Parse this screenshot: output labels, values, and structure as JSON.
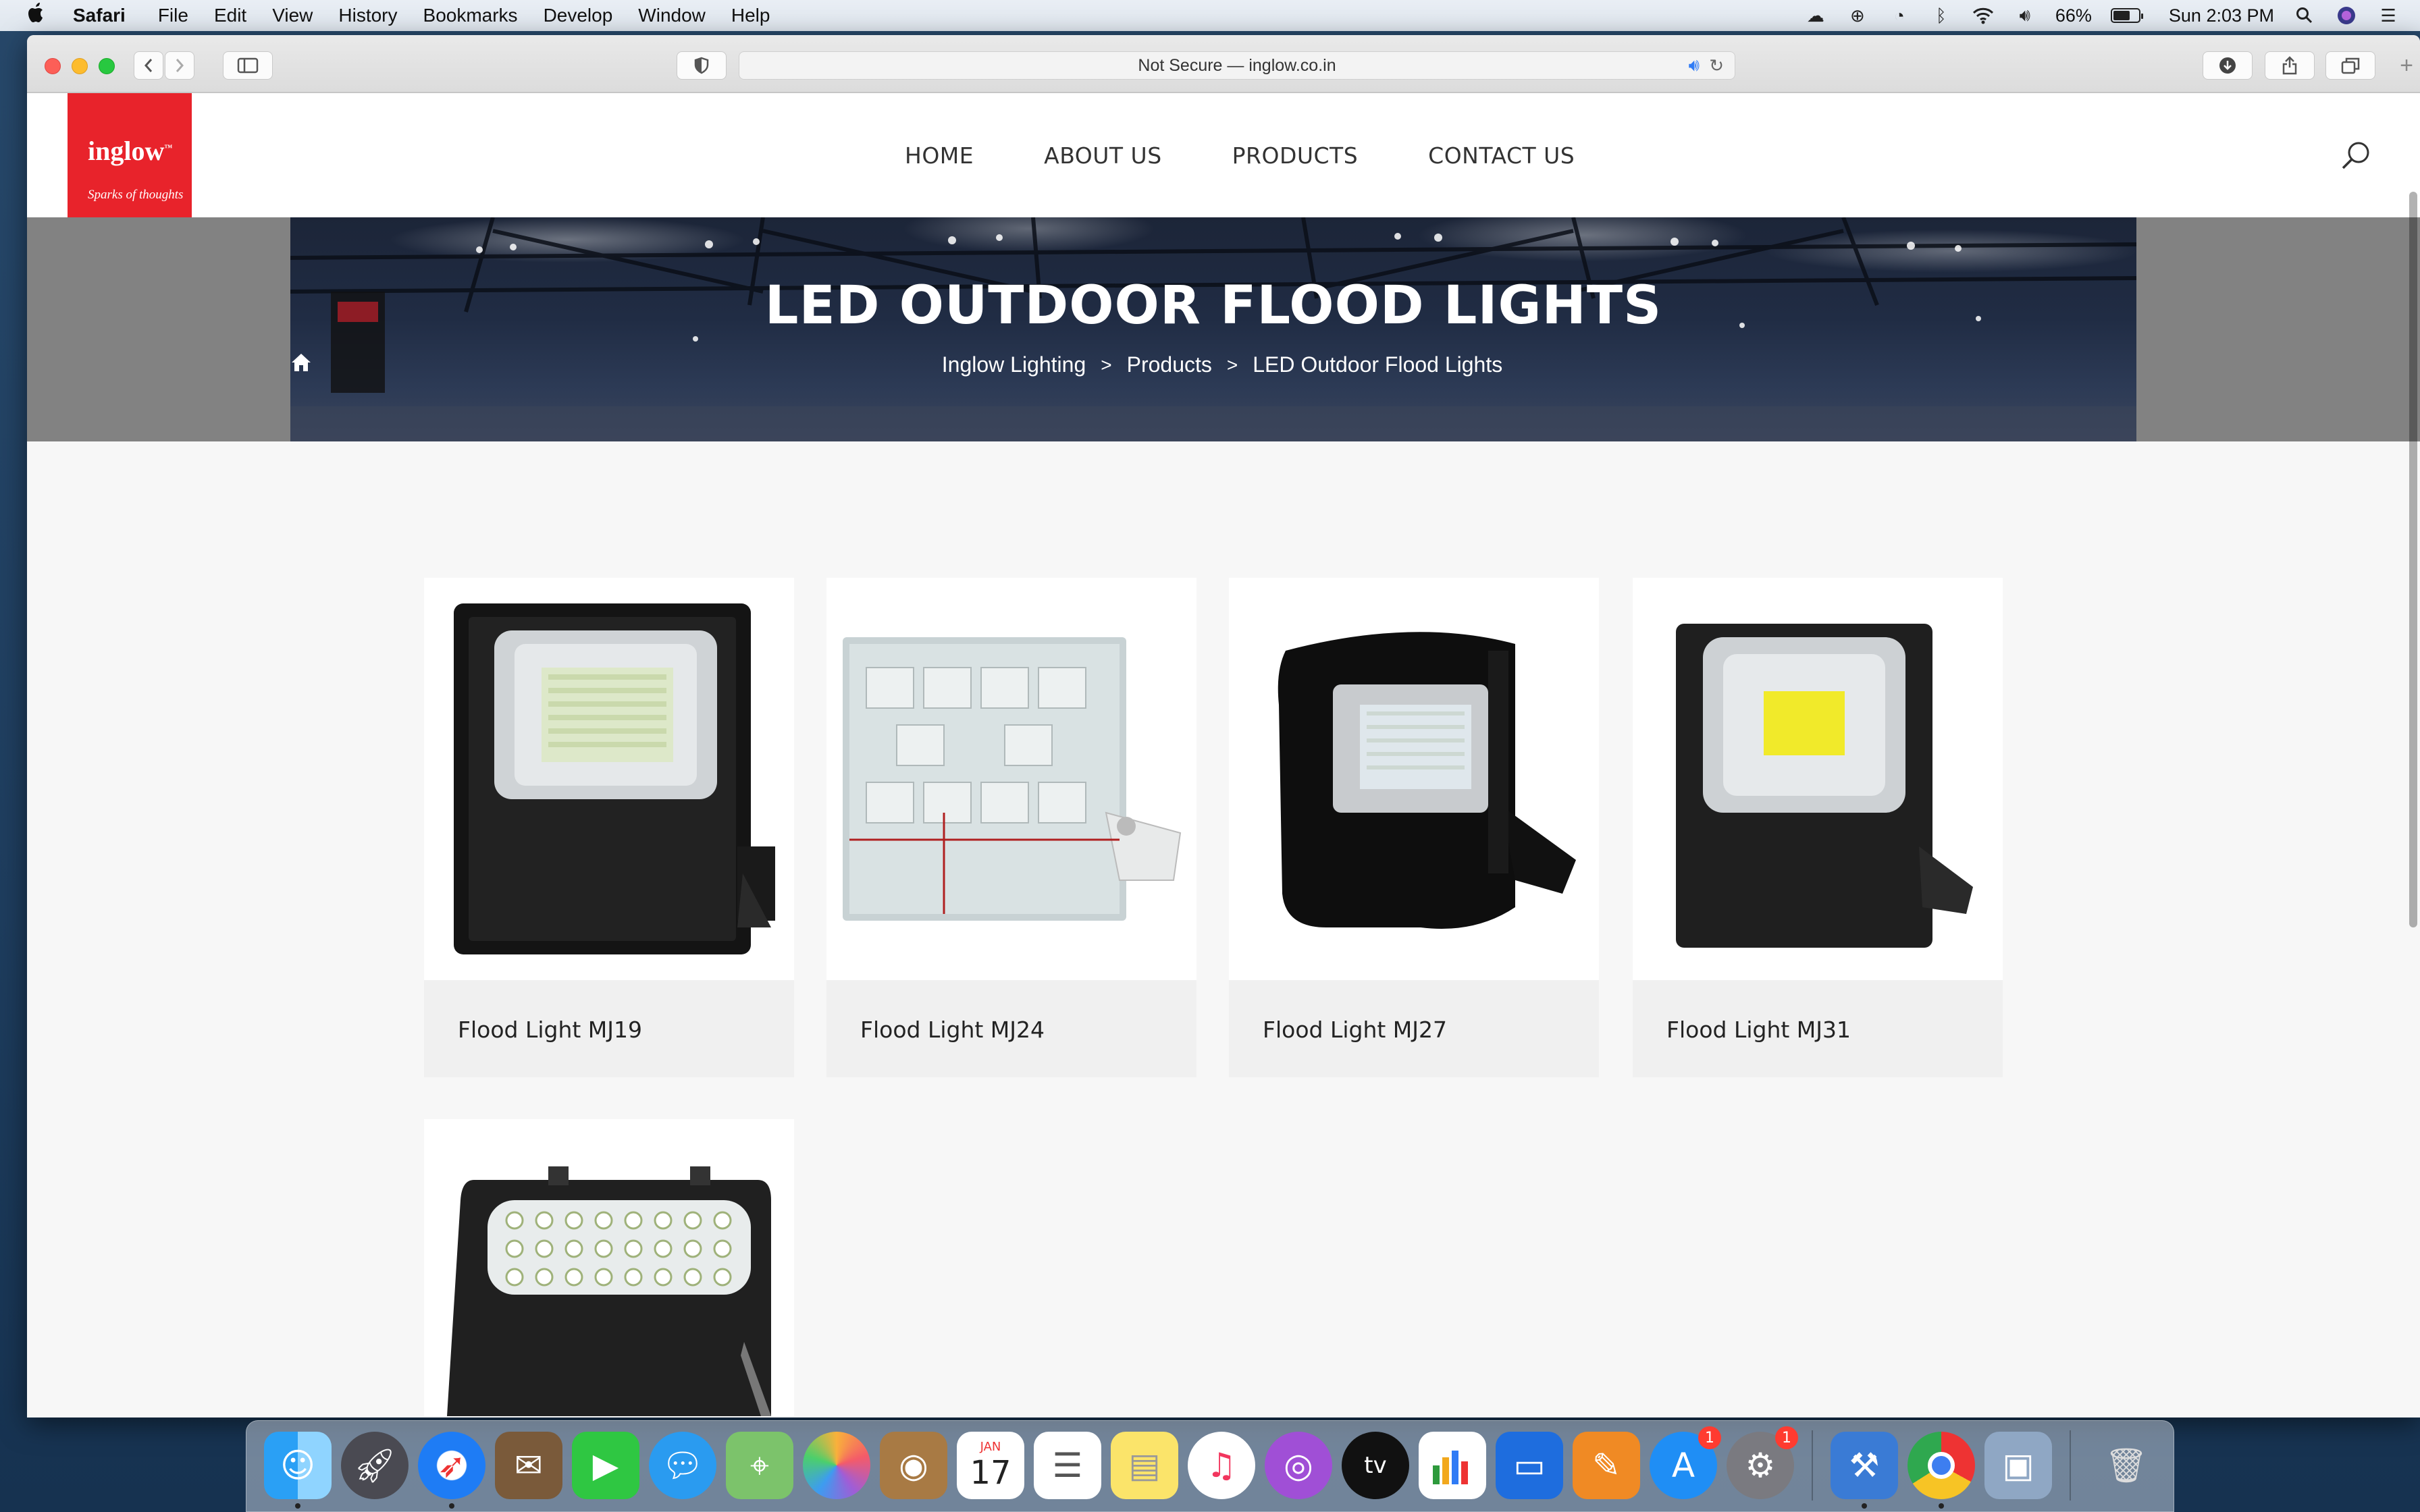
{
  "menubar": {
    "app": "Safari",
    "items": [
      "File",
      "Edit",
      "View",
      "History",
      "Bookmarks",
      "Develop",
      "Window",
      "Help"
    ],
    "battery_percent": "66%",
    "battery_level": 0.66,
    "clock": "Sun 2:03 PM"
  },
  "browser": {
    "address": "Not Secure — inglow.co.in"
  },
  "site": {
    "logo": {
      "brand": "inglow",
      "tm": "™",
      "tagline": "Sparks of thoughts",
      "color": "#e8232b"
    },
    "nav": [
      "HOME",
      "ABOUT US",
      "PRODUCTS",
      "CONTACT US"
    ]
  },
  "hero": {
    "title": "LED OUTDOOR FLOOD LIGHTS",
    "breadcrumb": [
      "Inglow Lighting",
      "Products",
      "LED Outdoor Flood Lights"
    ],
    "separator": ">"
  },
  "products": [
    {
      "name": "Flood Light MJ19"
    },
    {
      "name": "Flood Light MJ24"
    },
    {
      "name": "Flood Light MJ27"
    },
    {
      "name": "Flood Light MJ31"
    },
    {
      "name": ""
    }
  ],
  "dock": {
    "calendar_month": "JAN",
    "calendar_day": "17",
    "appstore_badge": "1",
    "settings_badge": "1"
  }
}
